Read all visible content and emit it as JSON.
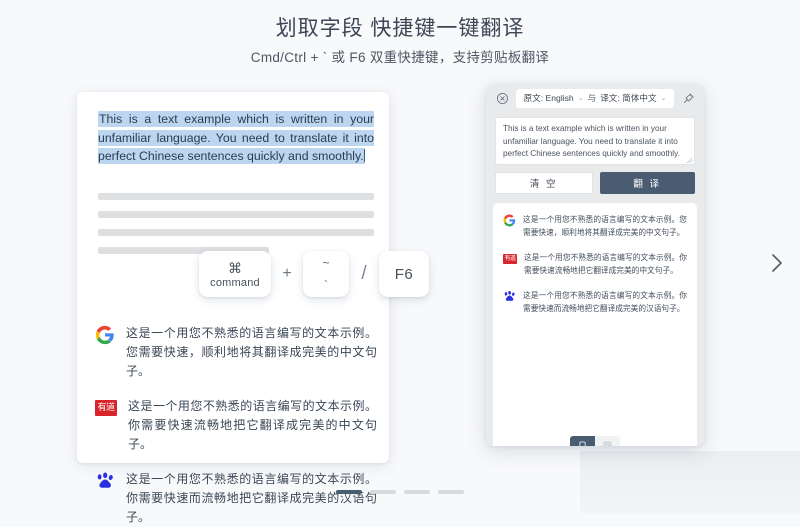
{
  "header": {
    "title": "划取字段 快捷键一键翻译",
    "subtitle": "Cmd/Ctrl + ` 或 F6 双重快捷键，支持剪贴板翻译"
  },
  "document_card": {
    "selected_text": "This is a text example which is written in your unfamiliar language. You need to translate it into perfect Chinese sentences quickly and smoothly.",
    "placeholder_lines": 4,
    "results": [
      {
        "engine": "google",
        "engine_label": "Google",
        "text": "这是一个用您不熟悉的语言编写的文本示例。您需要快速，顺利地将其翻译成完美的中文句子。"
      },
      {
        "engine": "youdao",
        "engine_label": "有道",
        "text": "这是一个用您不熟悉的语言编写的文本示例。你需要快速流畅地把它翻译成完美的中文句子。"
      },
      {
        "engine": "baidu",
        "engine_label": "百度",
        "text": "这是一个用您不熟悉的语言编写的文本示例。你需要快速而流畅地把它翻译成完美的汉语句子。"
      }
    ]
  },
  "shortcut_keys": {
    "command_glyph": "⌘",
    "command_label": "command",
    "plus": "+",
    "tilde_upper": "~",
    "tilde_lower": "`",
    "slash": "/",
    "f6_label": "F6"
  },
  "popup": {
    "close_icon": "circle-x-icon",
    "pin_icon": "pin-icon",
    "source_lang": "原文: English",
    "conjunction": "与",
    "target_lang": "译文: 简体中文",
    "chevron": "⌄",
    "input_text": "This is a text example which is written in your unfamiliar language. You need to translate it into perfect Chinese sentences quickly and smoothly.",
    "clear_label": "清 空",
    "translate_label": "翻 译",
    "results": [
      {
        "engine": "google",
        "engine_label": "Google",
        "text": "这是一个用您不熟悉的语言编写的文本示例。您需要快速，顺利地将其翻译成完美的中文句子。"
      },
      {
        "engine": "youdao",
        "engine_label": "有道",
        "text": "这是一个用您不熟悉的语言编写的文本示例。你需要快速流畅地把它翻译成完美的中文句子。"
      },
      {
        "engine": "baidu",
        "engine_label": "百度",
        "text": "这是一个用您不熟悉的语言编写的文本示例。你需要快速而流畅地把它翻译成完美的汉语句子。"
      }
    ],
    "footer_toggle": {
      "option_1": "copy-icon",
      "option_2": "window-icon",
      "selected": 1
    }
  },
  "navigation": {
    "next_icon": "chevron-right-icon",
    "pages": 4,
    "active_page": 1
  },
  "colors": {
    "accent": "#4a5c72",
    "selection": "#bdd6f0",
    "background": "#f8f9fb",
    "youdao_red": "#d7252b"
  }
}
